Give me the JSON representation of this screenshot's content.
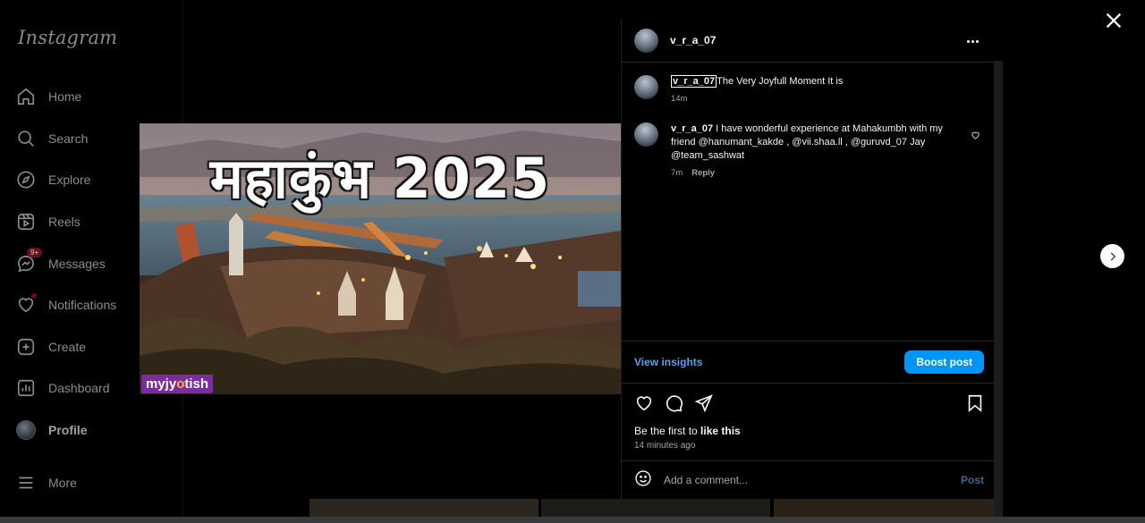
{
  "sidebar": {
    "logo": "Instagram",
    "items": [
      {
        "label": "Home",
        "icon": "home-icon"
      },
      {
        "label": "Search",
        "icon": "search-icon"
      },
      {
        "label": "Explore",
        "icon": "compass-icon"
      },
      {
        "label": "Reels",
        "icon": "reels-icon"
      },
      {
        "label": "Messages",
        "icon": "messenger-icon",
        "badge": "9+"
      },
      {
        "label": "Notifications",
        "icon": "heart-icon"
      },
      {
        "label": "Create",
        "icon": "plus-square-icon"
      },
      {
        "label": "Dashboard",
        "icon": "dashboard-icon"
      },
      {
        "label": "Profile",
        "icon": "avatar"
      },
      {
        "label": "More",
        "icon": "menu-icon"
      }
    ]
  },
  "media": {
    "title": "महाकुंभ 2025",
    "brand_pre": "myjy",
    "brand_o": "o",
    "brand_post": "tish"
  },
  "post": {
    "username": "v_r_a_07",
    "caption_user": "v_r_a_07",
    "caption_text": "The Very Joyfull Moment It is",
    "caption_time": "14m",
    "comment": {
      "user": "v_r_a_07",
      "text": " I have wonderful experience at Mahakumbh with my friend @hanumant_kakde , @vii.shaa.ll , @guruvd_07 Jay @team_sashwat",
      "time": "7m",
      "reply": "Reply"
    },
    "view_insights": "View insights",
    "boost_post": "Boost post",
    "likes_prefix": "Be the first to ",
    "likes_bold": "like this",
    "time_ago": "14 minutes ago",
    "comment_placeholder": "Add a comment...",
    "post_label": "Post"
  },
  "colors": {
    "accent": "#0095f6",
    "link": "#5aa0ec",
    "brand": "#7b2ca0"
  }
}
